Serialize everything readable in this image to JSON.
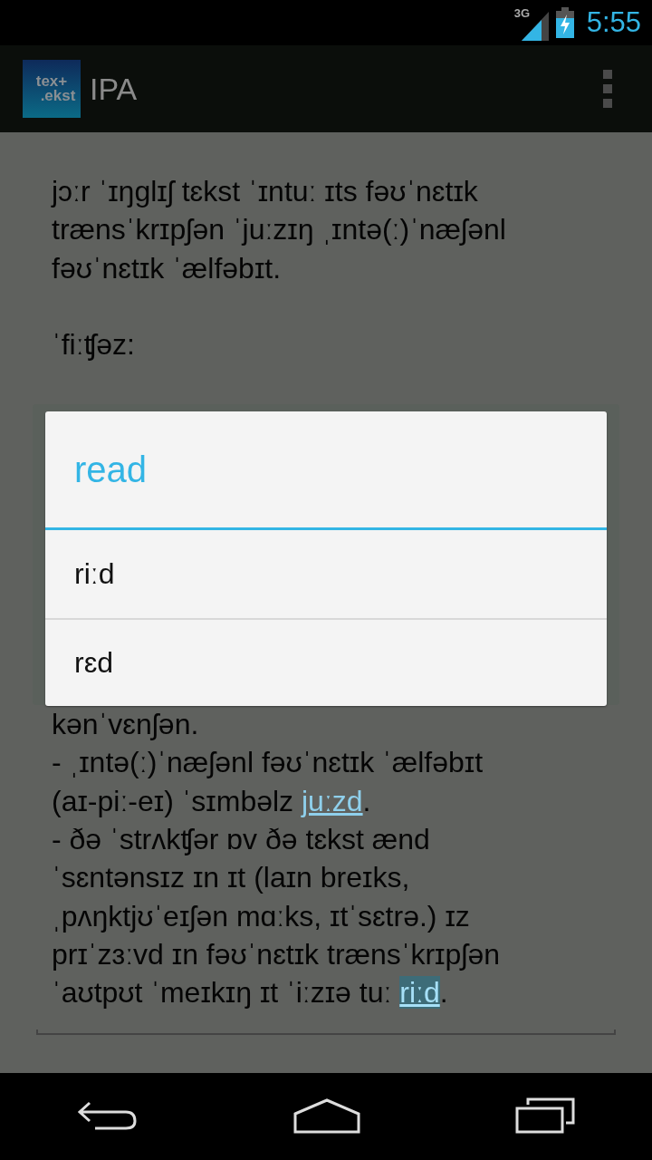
{
  "status_bar": {
    "network": "3G",
    "time": "5:55"
  },
  "action_bar": {
    "logo": [
      "tex+",
      ".ekst"
    ],
    "title": "IPA"
  },
  "article": {
    "blocks": [
      [
        {
          "lines": [
            [
              {
                "kind": "plain",
                "text": "jɔːr ˈɪŋglɪʃ tɛkst ˈɪntuː ɪts fəʊˈnɛtɪk"
              }
            ],
            [
              {
                "kind": "plain",
                "text": "trænsˈkrɪpʃən ˈjuːzɪŋ ˌɪntə(ː)ˈnæʃənl"
              }
            ],
            [
              {
                "kind": "plain",
                "text": "fəʊˈnɛtɪk ˈælfəbɪt."
              }
            ]
          ]
        },
        {
          "lines": [
            [
              {
                "kind": "plain",
                "text": "ˈfiːʧəz:"
              }
            ]
          ]
        }
      ],
      [
        {
          "lines": [
            [
              {
                "kind": "plain",
                "text": "kənˈvɛnʃən."
              }
            ],
            [
              {
                "kind": "plain",
                "text": "- ˌɪntə(ː)ˈnæʃənl fəʊˈnɛtɪk ˈælfəbɪt"
              }
            ],
            [
              {
                "kind": "plain",
                "text": "(aɪ-piː-eɪ) ˈsɪmbəlz "
              },
              {
                "kind": "link",
                "text": "juːzd",
                "selected": false
              },
              {
                "kind": "plain",
                "text": "."
              }
            ],
            [
              {
                "kind": "plain",
                "text": "- ðə ˈstrʌkʧər ɒv ðə tɛkst ænd"
              }
            ],
            [
              {
                "kind": "plain",
                "text": "ˈsɛntənsɪz ɪn ɪt (laɪn breɪks,"
              }
            ],
            [
              {
                "kind": "plain",
                "text": "ˌpʌŋktjʊˈeɪʃən mɑːks, ɪtˈsɛtrə.) ɪz"
              }
            ],
            [
              {
                "kind": "plain",
                "text": "prɪˈzɜːvd ɪn fəʊˈnɛtɪk trænsˈkrɪpʃən"
              }
            ],
            [
              {
                "kind": "plain",
                "text": "ˈaʊtpʊt ˈmeɪkɪŋ ɪt ˈiːzɪə tuː "
              },
              {
                "kind": "link",
                "text": "riːd",
                "selected": true
              },
              {
                "kind": "plain",
                "text": "."
              }
            ]
          ]
        }
      ]
    ]
  },
  "dialog": {
    "title": "read",
    "options": [
      "riːd",
      "rɛd"
    ]
  }
}
